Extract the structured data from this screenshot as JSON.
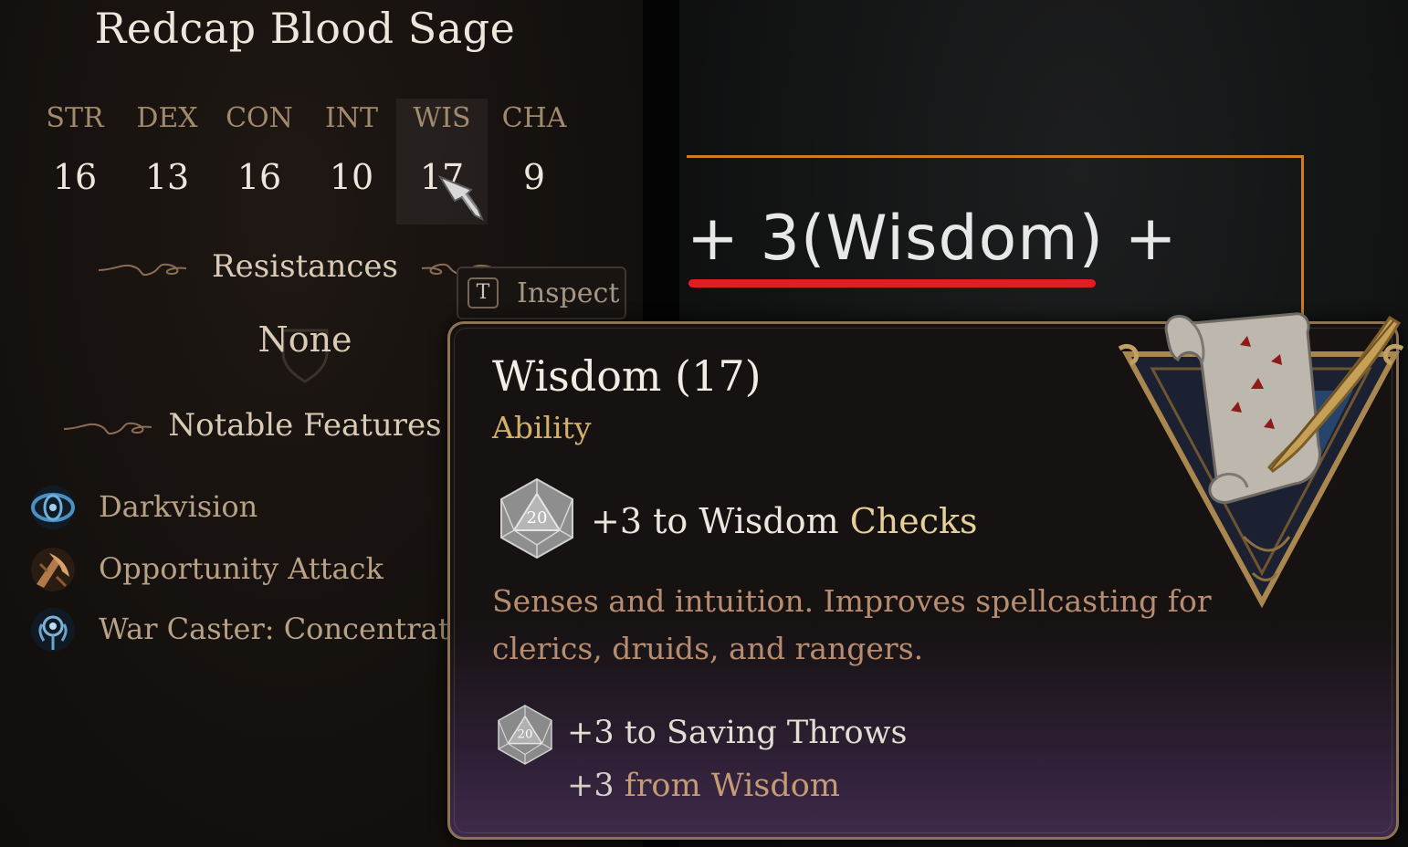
{
  "character": {
    "name": "Redcap Blood Sage"
  },
  "abilities": [
    {
      "label": "STR",
      "value": "16"
    },
    {
      "label": "DEX",
      "value": "13"
    },
    {
      "label": "CON",
      "value": "16"
    },
    {
      "label": "INT",
      "value": "10"
    },
    {
      "label": "WIS",
      "value": "17",
      "highlighted": true
    },
    {
      "label": "CHA",
      "value": "9"
    }
  ],
  "resistances": {
    "heading": "Resistances",
    "value": "None"
  },
  "notable_features": {
    "heading": "Notable Features",
    "items": [
      {
        "label": "Darkvision",
        "icon": "darkvision-icon"
      },
      {
        "label": "Opportunity Attack",
        "icon": "opportunity-attack-icon"
      },
      {
        "label": "War Caster: Concentration",
        "icon": "war-caster-icon"
      }
    ]
  },
  "inspect_hint": {
    "key": "T",
    "label": "Inspect"
  },
  "formula_overlay": {
    "text": "+ 3(Wisdom) +",
    "frame_color": "#d07b1c",
    "underline_color": "#e21f1f"
  },
  "tooltip": {
    "title": "Wisdom (17)",
    "subtitle": "Ability",
    "check_bonus": "+3  to Wisdom",
    "check_bonus_accent": " Checks",
    "die_label": "20",
    "description": "Senses and intuition. Improves spellcasting for clerics, druids, and rangers.",
    "saving_throw": "+3 to Saving Throws",
    "from_value": "+3 ",
    "from_source": "from Wisdom"
  },
  "colors": {
    "panel_bg": "#15110e",
    "tooltip_border": "#8d7353",
    "subtitle_gold": "#d2b06a",
    "stat_label": "#a48a6c"
  }
}
